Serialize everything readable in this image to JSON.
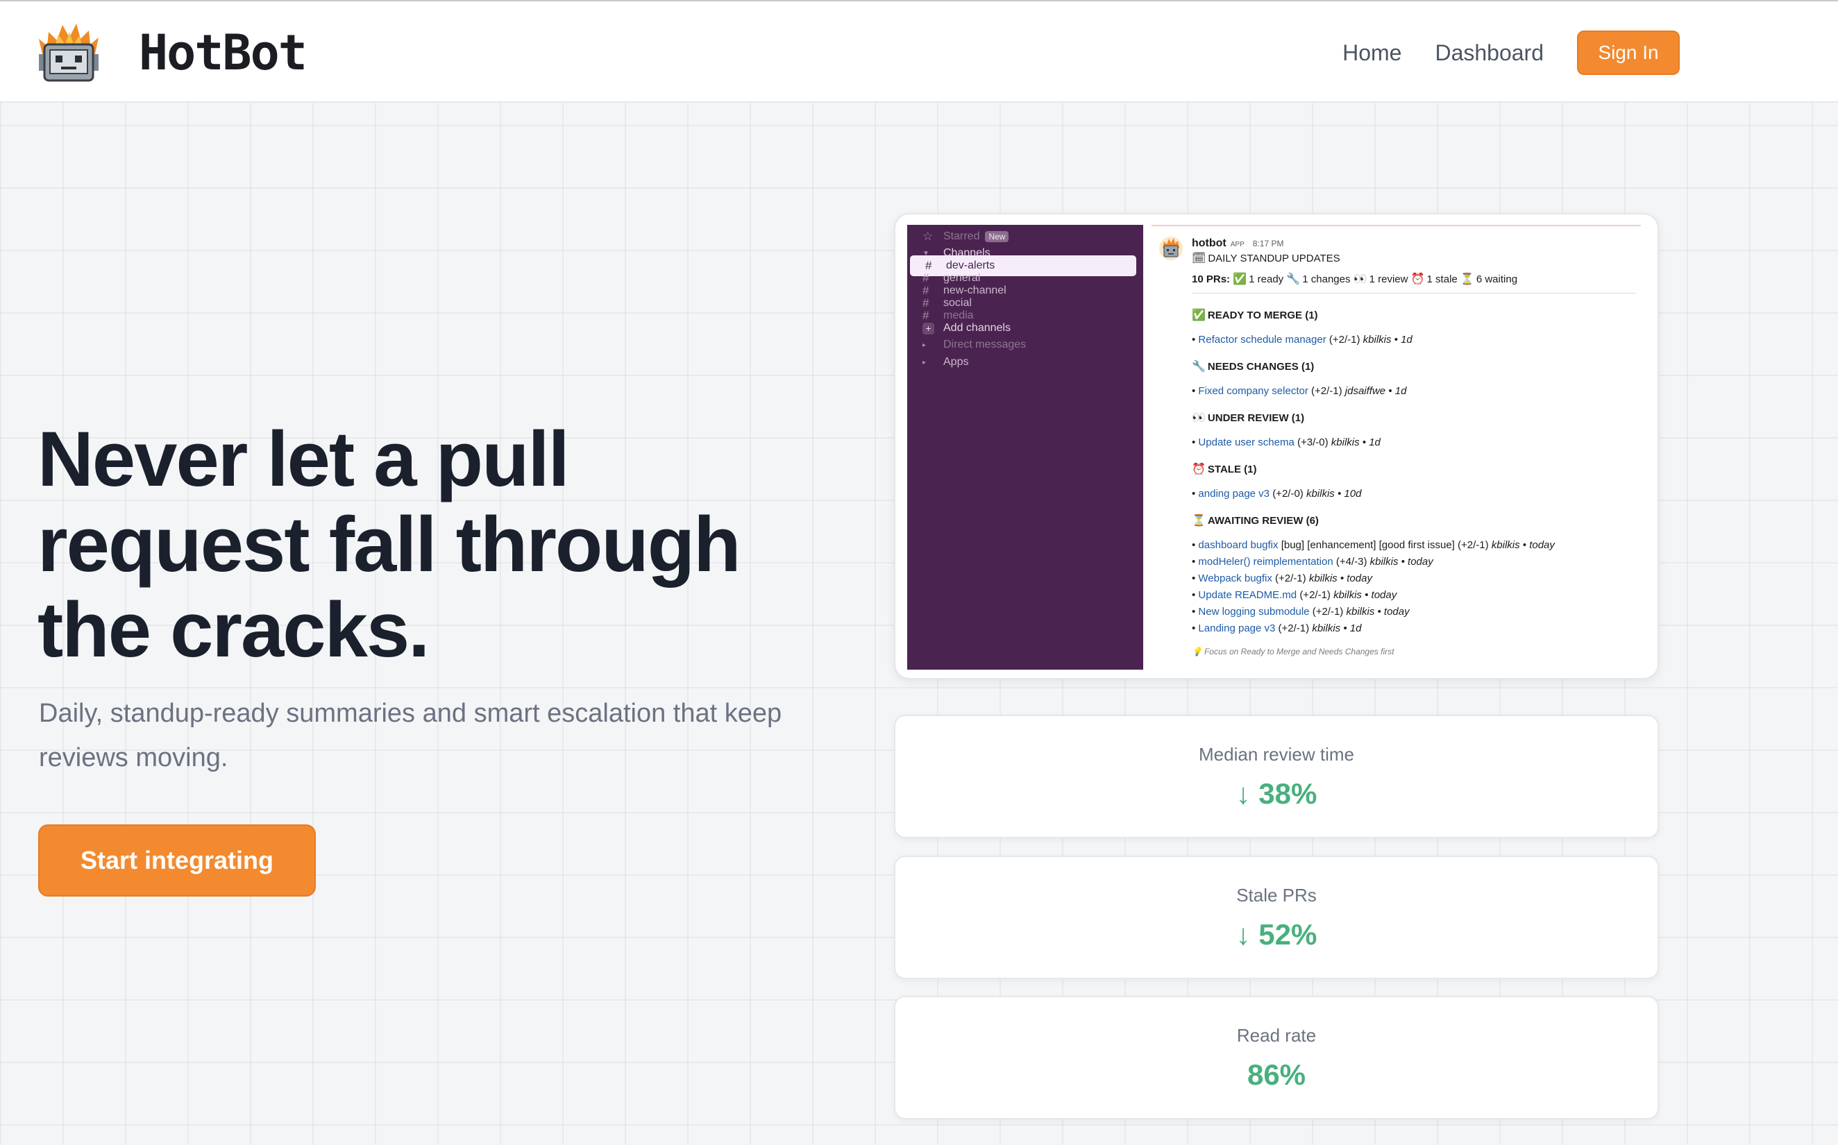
{
  "header": {
    "brand": "HotBot",
    "nav": {
      "home": "Home",
      "dashboard": "Dashboard",
      "sign_in": "Sign In"
    }
  },
  "hero": {
    "title": "Never let a pull request fall through the cracks.",
    "subtitle": "Daily, standup-ready summaries and smart escalation that keep reviews moving.",
    "cta": "Start integrating"
  },
  "slack": {
    "sidebar": {
      "starred": "Starred",
      "new_badge": "New",
      "channels_header": "Channels",
      "channels": [
        "dev-alerts",
        "general",
        "new-channel",
        "social",
        "media"
      ],
      "add_channels": "Add channels",
      "direct_messages": "Direct messages",
      "apps": "Apps"
    },
    "message": {
      "sender": "hotbot",
      "app_tag": "APP",
      "time": "8:17 PM",
      "title": "DAILY STANDUP UPDATES",
      "summary_count": "10 PRs:",
      "summary_ready": "1 ready",
      "summary_changes": "1 changes",
      "summary_review": "1 review",
      "summary_stale": "1 stale",
      "summary_waiting": "6 waiting",
      "ready_header": "READY TO MERGE (1)",
      "ready_item": {
        "link": "Refactor schedule manager",
        "diff": "(+2/-1)",
        "meta": "kbilkis • 1d"
      },
      "changes_header": "NEEDS CHANGES (1)",
      "changes_item": {
        "link": "Fixed company selector",
        "diff": "(+2/-1)",
        "meta": "jdsaiffwe • 1d"
      },
      "review_header": "UNDER REVIEW (1)",
      "review_item": {
        "link": "Update user schema",
        "diff": "(+3/-0)",
        "meta": "kbilkis • 1d"
      },
      "stale_header": "STALE (1)",
      "stale_item": {
        "link": "anding page v3",
        "diff": "(+2/-0)",
        "meta": "kbilkis • 10d"
      },
      "awaiting_header": "AWAITING REVIEW (6)",
      "awaiting_items": [
        {
          "link": "dashboard bugfix",
          "diff": "[bug] [enhancement] [good first issue] (+2/-1)",
          "meta": "kbilkis • today"
        },
        {
          "link": "modHeler() reimplementation",
          "diff": "(+4/-3)",
          "meta": "kbilkis • today"
        },
        {
          "link": "Webpack bugfix",
          "diff": "(+2/-1)",
          "meta": "kbilkis • today"
        },
        {
          "link": "Update README.md",
          "diff": "(+2/-1)",
          "meta": "kbilkis • today"
        },
        {
          "link": "New logging submodule",
          "diff": "(+2/-1)",
          "meta": "kbilkis • today"
        },
        {
          "link": "Landing page v3",
          "diff": "(+2/-1)",
          "meta": "kbilkis • 1d"
        }
      ],
      "hint": "Focus on Ready to Merge and Needs Changes first"
    }
  },
  "stats": [
    {
      "label": "Median review time",
      "value": "↓ 38%"
    },
    {
      "label": "Stale PRs",
      "value": "↓ 52%"
    },
    {
      "label": "Read rate",
      "value": "86%"
    }
  ],
  "colors": {
    "accent": "#f38a2f",
    "stat_green": "#48b07d",
    "slack_sidebar": "#4b2350",
    "link": "#1d5ba7"
  }
}
